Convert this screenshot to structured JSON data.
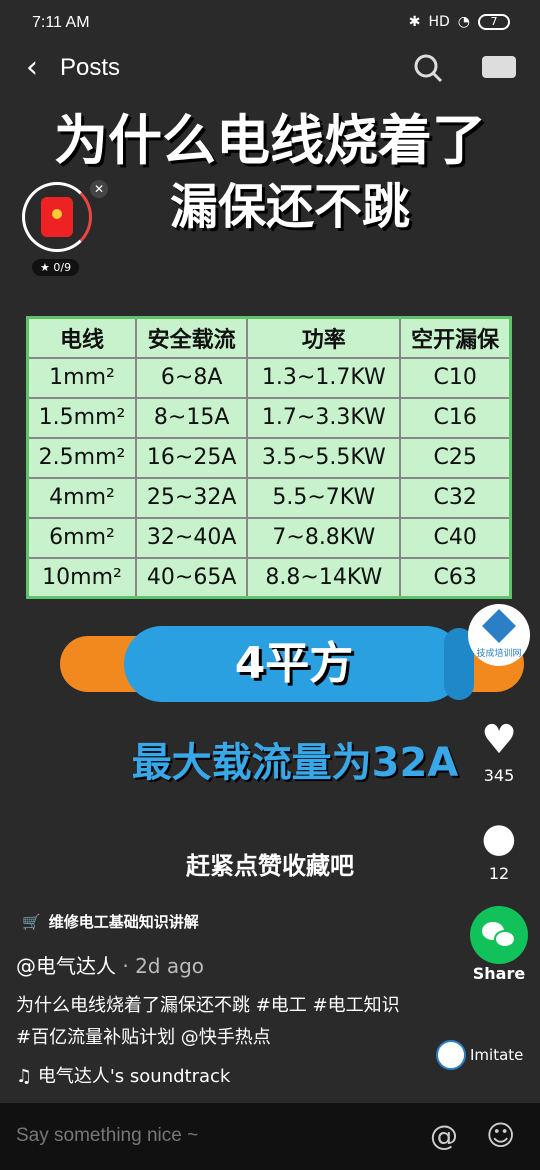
{
  "status": {
    "time": "7:11 AM",
    "battery": "7",
    "network": "HD"
  },
  "nav": {
    "back_label": "Posts"
  },
  "headline": {
    "line1": "为什么电线烧着了",
    "line2": "漏保还不跳"
  },
  "reward": {
    "progress": "0/9"
  },
  "table": {
    "headers": [
      "电线",
      "安全载流",
      "功率",
      "空开漏保"
    ],
    "rows": [
      [
        "1mm²",
        "6~8A",
        "1.3~1.7KW",
        "C10"
      ],
      [
        "1.5mm²",
        "8~15A",
        "1.7~3.3KW",
        "C16"
      ],
      [
        "2.5mm²",
        "16~25A",
        "3.5~5.5KW",
        "C25"
      ],
      [
        "4mm²",
        "25~32A",
        "5.5~7KW",
        "C32"
      ],
      [
        "6mm²",
        "32~40A",
        "7~8.8KW",
        "C40"
      ],
      [
        "10mm²",
        "40~65A",
        "8.8~14KW",
        "C63"
      ]
    ]
  },
  "cable_label": "4平方",
  "max_load": "最大载流量为32A",
  "cta": "赶紧点赞收藏吧",
  "brand_badge": "技成培训网",
  "likes": "345",
  "comments": "12",
  "share_label": "Share",
  "shop_label": "维修电工基础知识讲解",
  "author": {
    "name": "@电气达人",
    "ago": "2d ago"
  },
  "caption": "为什么电线烧着了漏保还不跳 #电工 #电工知识 #百亿流量补贴计划 @快手热点",
  "soundtrack": "电气达人's soundtrack",
  "imitate_label": "Imitate",
  "comment_placeholder": "Say something nice ~",
  "colors": {
    "background": "#2a2a2a",
    "table_bg": "#c8f2cc",
    "accent_blue": "#39a8e8",
    "share_green": "#11c25a"
  }
}
